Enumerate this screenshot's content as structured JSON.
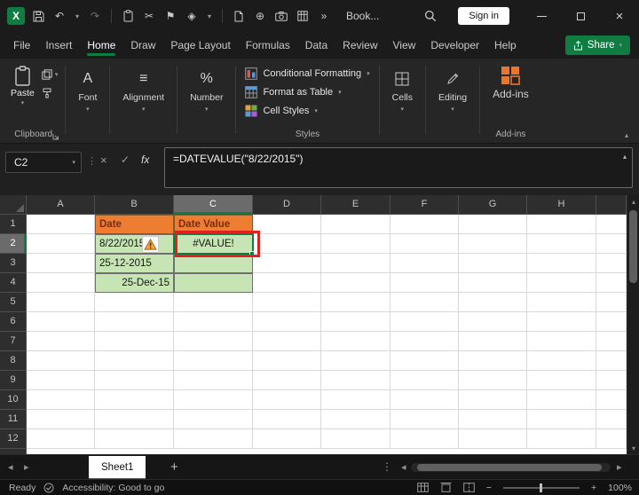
{
  "titlebar": {
    "title": "Book...",
    "sign_in": "Sign in"
  },
  "glyphs": {
    "undo": "↶",
    "redo": "↷",
    "cut": "✂",
    "flag": "⚑",
    "diamond": "◈",
    "plus": "⊕",
    "overflow": "»",
    "close": "×",
    "chevron_down": "▾",
    "chevron_up": "▴",
    "left": "◂",
    "right": "▸",
    "dots": "⋮"
  },
  "menubar": {
    "tabs": [
      "File",
      "Insert",
      "Home",
      "Draw",
      "Page Layout",
      "Formulas",
      "Data",
      "Review",
      "View",
      "Developer",
      "Help"
    ],
    "active": "Home",
    "share": "Share"
  },
  "ribbon": {
    "paste": "Paste",
    "clipboard_label": "Clipboard",
    "font": {
      "label": "Font",
      "glyph": "A"
    },
    "alignment": {
      "label": "Alignment",
      "glyph": "≡"
    },
    "number": {
      "label": "Number",
      "glyph": "%"
    },
    "styles_items": [
      "Conditional Formatting",
      "Format as Table",
      "Cell Styles"
    ],
    "styles_label": "Styles",
    "cells_label": "Cells",
    "editing_label": "Editing",
    "addins_button": "Add-ins",
    "addins_label": "Add-ins"
  },
  "formula_bar": {
    "name_box": "C2",
    "cancel": "×",
    "enter": "✓",
    "fx": "fx",
    "formula": "=DATEVALUE(\"8/22/2015\")"
  },
  "grid": {
    "columns": [
      "A",
      "B",
      "C",
      "D",
      "E",
      "F",
      "G",
      "H"
    ],
    "rows": [
      "1",
      "2",
      "3",
      "4",
      "5",
      "6",
      "7",
      "8",
      "9",
      "10",
      "11",
      "12"
    ],
    "active_column": "C",
    "active_row": "2",
    "cells": [
      {
        "ref": "B1",
        "text": "Date",
        "style": "header-orange",
        "align": "left"
      },
      {
        "ref": "C1",
        "text": "Date Value",
        "style": "header-orange",
        "align": "left"
      },
      {
        "ref": "B2",
        "text": "8/22/2015",
        "style": "green",
        "align": "left"
      },
      {
        "ref": "C2",
        "text": "#VALUE!",
        "style": "green",
        "align": "center"
      },
      {
        "ref": "B3",
        "text": "25-12-2015",
        "style": "green",
        "align": "left"
      },
      {
        "ref": "C3",
        "text": "",
        "style": "green"
      },
      {
        "ref": "B4",
        "text": "25-Dec-15",
        "style": "green",
        "align": "right"
      },
      {
        "ref": "C4",
        "text": "",
        "style": "green"
      }
    ]
  },
  "sheetbar": {
    "tab": "Sheet1",
    "add": "+"
  },
  "statusbar": {
    "ready": "Ready",
    "accessibility": "Accessibility: Good to go",
    "zoom": "100%",
    "zoom_out": "−",
    "zoom_in": "+"
  },
  "colors": {
    "accent_green": "#107C41",
    "header_orange": "#ED7D31",
    "cell_green": "#C7E4B5",
    "annotation_red": "#E3201F",
    "addins_orange": "#E8762C"
  }
}
